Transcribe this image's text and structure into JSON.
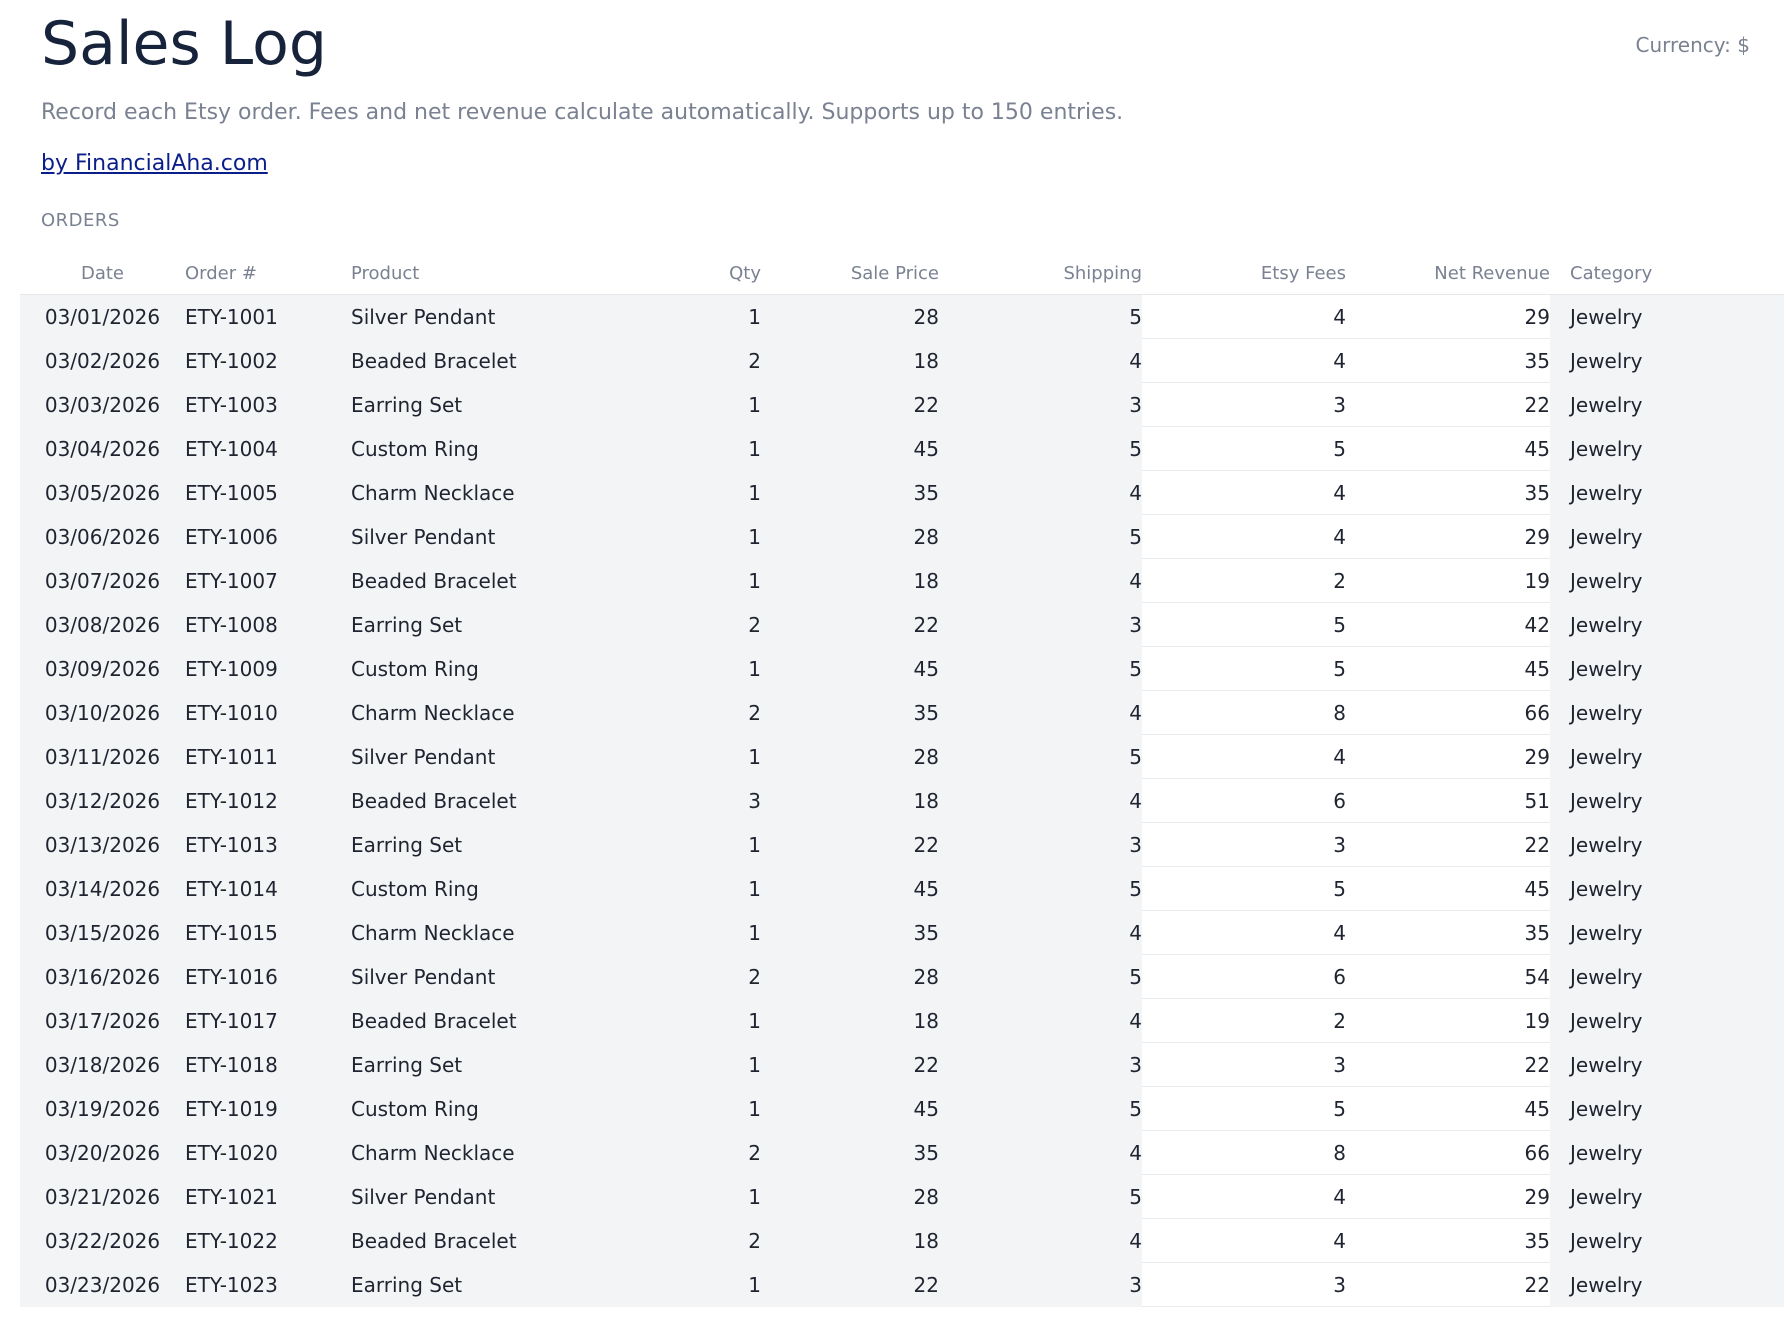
{
  "header": {
    "title": "Sales Log",
    "currency": "Currency: $",
    "subtitle": "Record each Etsy order. Fees and net revenue calculate automatically. Supports up to 150 entries.",
    "byline": "by FinancialAha.com"
  },
  "section_label": "ORDERS",
  "table": {
    "columns": [
      "Date",
      "Order #",
      "Product",
      "Qty",
      "Sale Price",
      "Shipping",
      "Etsy Fees",
      "Net Revenue",
      "Category"
    ],
    "rows": [
      [
        "03/01/2026",
        "ETY-1001",
        "Silver Pendant",
        "1",
        "28",
        "5",
        "4",
        "29",
        "Jewelry"
      ],
      [
        "03/02/2026",
        "ETY-1002",
        "Beaded Bracelet",
        "2",
        "18",
        "4",
        "4",
        "35",
        "Jewelry"
      ],
      [
        "03/03/2026",
        "ETY-1003",
        "Earring Set",
        "1",
        "22",
        "3",
        "3",
        "22",
        "Jewelry"
      ],
      [
        "03/04/2026",
        "ETY-1004",
        "Custom Ring",
        "1",
        "45",
        "5",
        "5",
        "45",
        "Jewelry"
      ],
      [
        "03/05/2026",
        "ETY-1005",
        "Charm Necklace",
        "1",
        "35",
        "4",
        "4",
        "35",
        "Jewelry"
      ],
      [
        "03/06/2026",
        "ETY-1006",
        "Silver Pendant",
        "1",
        "28",
        "5",
        "4",
        "29",
        "Jewelry"
      ],
      [
        "03/07/2026",
        "ETY-1007",
        "Beaded Bracelet",
        "1",
        "18",
        "4",
        "2",
        "19",
        "Jewelry"
      ],
      [
        "03/08/2026",
        "ETY-1008",
        "Earring Set",
        "2",
        "22",
        "3",
        "5",
        "42",
        "Jewelry"
      ],
      [
        "03/09/2026",
        "ETY-1009",
        "Custom Ring",
        "1",
        "45",
        "5",
        "5",
        "45",
        "Jewelry"
      ],
      [
        "03/10/2026",
        "ETY-1010",
        "Charm Necklace",
        "2",
        "35",
        "4",
        "8",
        "66",
        "Jewelry"
      ],
      [
        "03/11/2026",
        "ETY-1011",
        "Silver Pendant",
        "1",
        "28",
        "5",
        "4",
        "29",
        "Jewelry"
      ],
      [
        "03/12/2026",
        "ETY-1012",
        "Beaded Bracelet",
        "3",
        "18",
        "4",
        "6",
        "51",
        "Jewelry"
      ],
      [
        "03/13/2026",
        "ETY-1013",
        "Earring Set",
        "1",
        "22",
        "3",
        "3",
        "22",
        "Jewelry"
      ],
      [
        "03/14/2026",
        "ETY-1014",
        "Custom Ring",
        "1",
        "45",
        "5",
        "5",
        "45",
        "Jewelry"
      ],
      [
        "03/15/2026",
        "ETY-1015",
        "Charm Necklace",
        "1",
        "35",
        "4",
        "4",
        "35",
        "Jewelry"
      ],
      [
        "03/16/2026",
        "ETY-1016",
        "Silver Pendant",
        "2",
        "28",
        "5",
        "6",
        "54",
        "Jewelry"
      ],
      [
        "03/17/2026",
        "ETY-1017",
        "Beaded Bracelet",
        "1",
        "18",
        "4",
        "2",
        "19",
        "Jewelry"
      ],
      [
        "03/18/2026",
        "ETY-1018",
        "Earring Set",
        "1",
        "22",
        "3",
        "3",
        "22",
        "Jewelry"
      ],
      [
        "03/19/2026",
        "ETY-1019",
        "Custom Ring",
        "1",
        "45",
        "5",
        "5",
        "45",
        "Jewelry"
      ],
      [
        "03/20/2026",
        "ETY-1020",
        "Charm Necklace",
        "2",
        "35",
        "4",
        "8",
        "66",
        "Jewelry"
      ],
      [
        "03/21/2026",
        "ETY-1021",
        "Silver Pendant",
        "1",
        "28",
        "5",
        "4",
        "29",
        "Jewelry"
      ],
      [
        "03/22/2026",
        "ETY-1022",
        "Beaded Bracelet",
        "2",
        "18",
        "4",
        "4",
        "35",
        "Jewelry"
      ],
      [
        "03/23/2026",
        "ETY-1023",
        "Earring Set",
        "1",
        "22",
        "3",
        "3",
        "22",
        "Jewelry"
      ]
    ]
  },
  "colors": {
    "title": "#17223b",
    "muted": "#7a8191",
    "link": "#0b1f8a",
    "row_bg": "#f3f4f6",
    "calc_bg": "#ffffff"
  }
}
